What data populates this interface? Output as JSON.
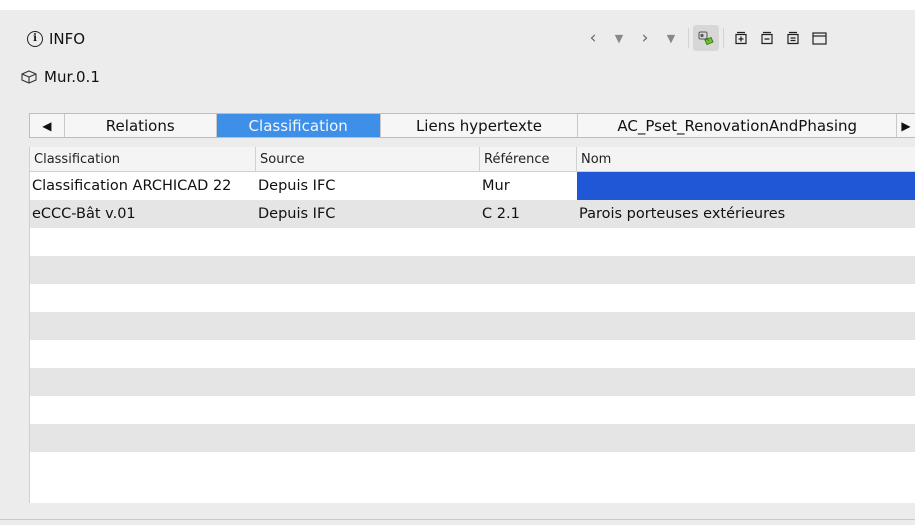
{
  "header": {
    "title": "INFO",
    "toolbar": {
      "icons": [
        "chevron-left-icon",
        "dropdown-triangle-icon",
        "chevron-right-icon",
        "dropdown-triangle-icon",
        "selection-filter-icon",
        "expand-all-icon",
        "collapse-all-icon",
        "equalize-icon",
        "panel-layout-icon"
      ],
      "chev_left": "‹",
      "chev_right": "›",
      "tri_down": "▼"
    }
  },
  "object": {
    "name": "Mur.0.1"
  },
  "tabs": {
    "left_arrow": "◀",
    "right_arrow": "▶",
    "items": [
      {
        "label": "Relations"
      },
      {
        "label": "Classification"
      },
      {
        "label": "Liens hypertexte"
      },
      {
        "label": "AC_Pset_RenovationAndPhasing"
      }
    ],
    "selected_index": 1
  },
  "table": {
    "columns": [
      "Classification",
      "Source",
      "Référence",
      "Nom"
    ],
    "rows": [
      {
        "classification": "Classification ARCHICAD 22",
        "source": "Depuis IFC",
        "reference": "Mur",
        "nom": ""
      },
      {
        "classification": "eCCC-Bât v.01",
        "source": "Depuis IFC",
        "reference": "C 2.1",
        "nom": "Parois porteuses extérieures"
      }
    ]
  },
  "colors": {
    "selected_tab": "#3d8fe8",
    "selected_cell": "#1f57d6",
    "stripe": "#e5e5e5",
    "panel": "#ececec"
  }
}
